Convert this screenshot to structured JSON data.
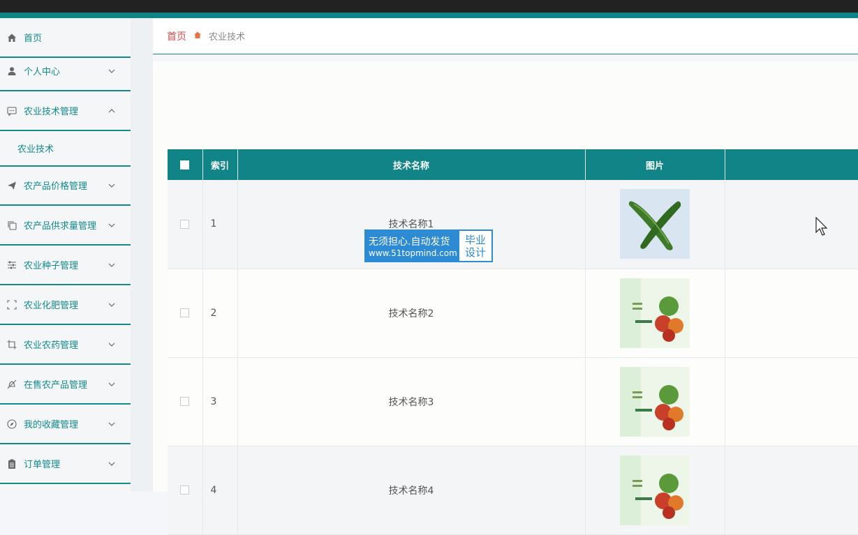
{
  "sidebar": {
    "items": [
      {
        "label": "首页",
        "icon": "home-icon",
        "expandable": false
      },
      {
        "label": "个人中心",
        "icon": "user-icon",
        "expandable": true
      },
      {
        "label": "农业技术管理",
        "icon": "message-icon",
        "expandable": true,
        "expanded": true,
        "children": [
          "农业技术"
        ]
      },
      {
        "label": "农产品价格管理",
        "icon": "send-icon",
        "expandable": true
      },
      {
        "label": "农产品供求量管理",
        "icon": "copy-icon",
        "expandable": true
      },
      {
        "label": "农业种子管理",
        "icon": "sliders-icon",
        "expandable": true
      },
      {
        "label": "农业化肥管理",
        "icon": "fullscreen-icon",
        "expandable": true
      },
      {
        "label": "农业农药管理",
        "icon": "crop-icon",
        "expandable": true
      },
      {
        "label": "在售农产品管理",
        "icon": "bell-off-icon",
        "expandable": true
      },
      {
        "label": "我的收藏管理",
        "icon": "compass-icon",
        "expandable": true
      },
      {
        "label": "订单管理",
        "icon": "clipboard-icon",
        "expandable": true
      }
    ]
  },
  "breadcrumb": {
    "home": "首页",
    "current": "农业技术"
  },
  "table": {
    "headers": {
      "index": "索引",
      "name": "技术名称",
      "image": "图片",
      "extra": ""
    },
    "rows": [
      {
        "index": "1",
        "name": "技术名称1",
        "image": "cucumber"
      },
      {
        "index": "2",
        "name": "技术名称2",
        "image": "vegetables-poster"
      },
      {
        "index": "3",
        "name": "技术名称3",
        "image": "vegetables-poster"
      },
      {
        "index": "4",
        "name": "技术名称4",
        "image": "vegetables-poster"
      }
    ]
  },
  "watermark": {
    "line1": "无须担心.自动发货",
    "line2": "www.51topmind.com",
    "right1": "毕业",
    "right2": "设计"
  },
  "colors": {
    "accent": "#108487",
    "topbar": "#222222",
    "home_link": "#d84a4a",
    "watermark": "#2c8bd2"
  }
}
